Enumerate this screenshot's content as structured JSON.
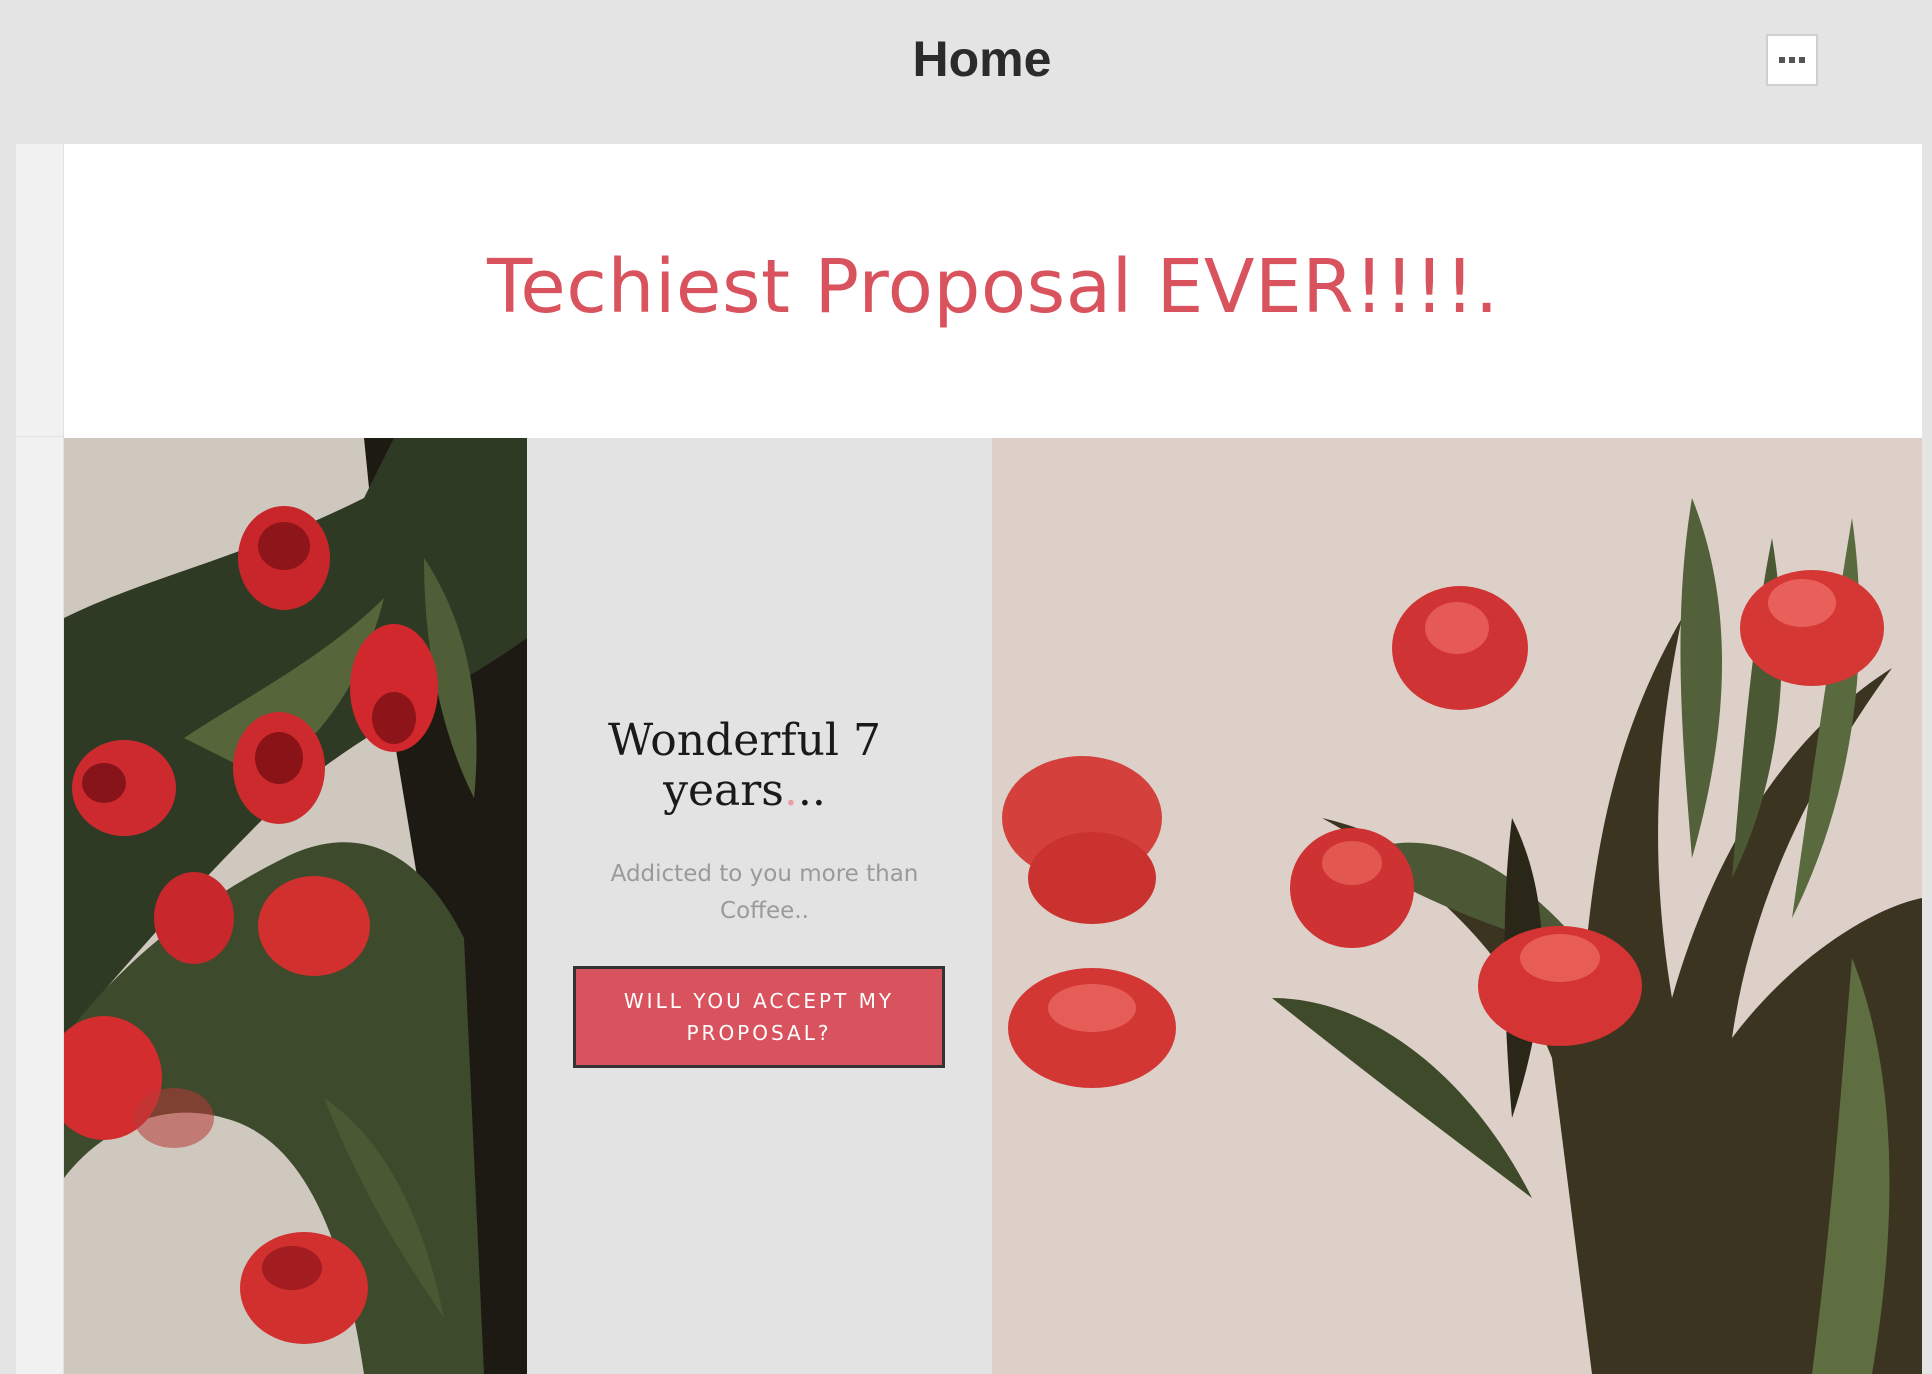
{
  "topbar": {
    "title": "Home",
    "more_icon": "ellipsis-icon"
  },
  "header": {
    "headline": "Techiest Proposal EVER!!!!."
  },
  "middle": {
    "heading_line1": "Wonderful 7",
    "heading_line2_word": "years",
    "heading_line2_accent": ".",
    "heading_line2_tail": "..",
    "subtitle": "Addicted to you more than Coffee..",
    "button_label": "WILL YOU ACCEPT MY PROPOSAL?"
  },
  "images": {
    "left_alt": "red tulips on cloth",
    "right_alt": "red tulip bouquet"
  },
  "colors": {
    "accent": "#d9535f",
    "topbar_bg": "#e4e4e4",
    "panel_bg": "#e3e3e3",
    "heading_text": "#1a1a1a",
    "subtitle_text": "#9a9a9a"
  }
}
